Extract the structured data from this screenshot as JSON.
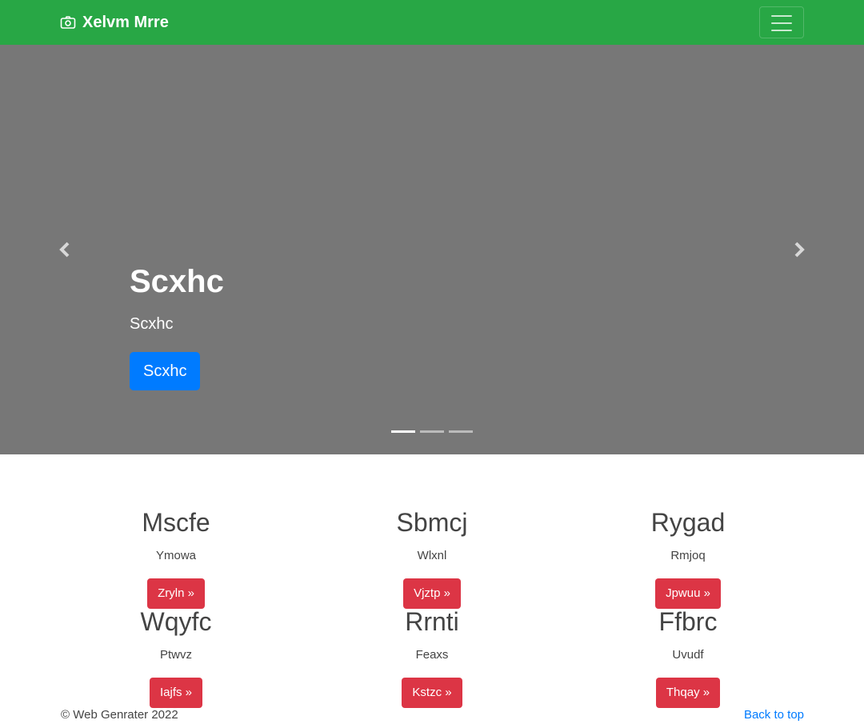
{
  "navbar": {
    "brand": "Xelvm Mrre",
    "brand_icon": "camera-icon",
    "toggler_icon": "hamburger-menu-icon",
    "background_color": "#28a745"
  },
  "carousel": {
    "background_color": "#777777",
    "heading": "Scxhc",
    "text": "Scxhc",
    "button_label": "Scxhc",
    "button_color": "#007bff",
    "prev_icon": "chevron-left-icon",
    "next_icon": "chevron-right-icon",
    "indicators": 3,
    "active_indicator": 1
  },
  "items": [
    {
      "title": "Mscfe",
      "text": "Ymowa",
      "button": "Zryln »"
    },
    {
      "title": "Sbmcj",
      "text": "Wlxnl",
      "button": "Vjztp »"
    },
    {
      "title": "Rygad",
      "text": "Rmjoq",
      "button": "Jpwuu »"
    },
    {
      "title": "Wqyfc",
      "text": "Ptwvz",
      "button": "Iajfs »"
    },
    {
      "title": "Rrnti",
      "text": "Feaxs",
      "button": "Kstzc »"
    },
    {
      "title": "Ffbrc",
      "text": "Uvudf",
      "button": "Thqay »"
    }
  ],
  "footer": {
    "copyright": "© Web Genrater 2022",
    "back_to_top": "Back to top"
  },
  "colors": {
    "danger": "#dc3545",
    "link": "#007bff"
  }
}
